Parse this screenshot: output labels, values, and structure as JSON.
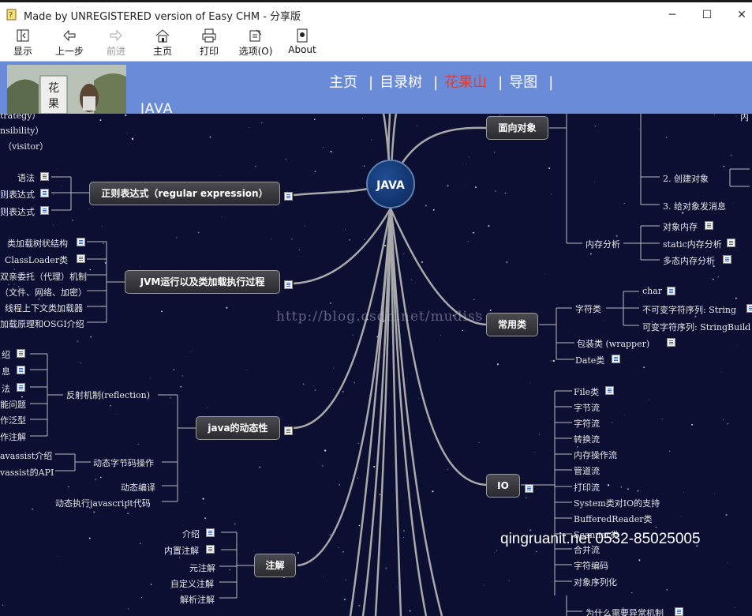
{
  "window": {
    "title": "Made by UNREGISTERED version of Easy CHM - 分享版",
    "minimize": "─",
    "maximize": "☐",
    "close": "✕"
  },
  "toolbar": {
    "show": "显示",
    "back": "上一步",
    "forward": "前进",
    "home": "主页",
    "print": "打印",
    "options": "选项(O)",
    "about": "About"
  },
  "header": {
    "nav": [
      "主页",
      "目录树",
      "花果山",
      "导图"
    ],
    "separator": "|",
    "active_index": 2,
    "java_label": "JAVA"
  },
  "mindmap": {
    "center": "JAVA",
    "main_nodes": {
      "oop": "面向对象",
      "regex": "正则表达式（regular expression）",
      "jvm": "JVM运行以及类加载执行过程",
      "common": "常用类",
      "dynamic": "java的动态性",
      "io": "IO",
      "annotation": "注解"
    },
    "leaves": {
      "strategy": "trategy）",
      "responsibility": "nsibility）",
      "visitor": "（visitor）",
      "regex_syntax": "语法",
      "regex_2": "则表达式",
      "regex_3": "则表达式",
      "jvm_1": "类加载树状结构",
      "jvm_2": "ClassLoader类",
      "jvm_3": "双亲委托（代理）机制",
      "jvm_4": "（文件、网络、加密）",
      "jvm_5": "线程上下文类加载器",
      "jvm_6": "加载原理和OSGI介绍",
      "dyn_reflection": "反射机制(reflection)",
      "dyn_bytecode": "动态字节码操作",
      "dyn_compile": "动态编译",
      "dyn_js": "动态执行javascript代码",
      "dyn_l1": "绍",
      "dyn_l2": "息",
      "dyn_l3": "法",
      "dyn_l4": "能问题",
      "dyn_l5": "作泛型",
      "dyn_l6": "作注解",
      "javassist_1": "avassist介绍",
      "javassist_2": "vassist的API",
      "ann_1": "介绍",
      "ann_2": "内置注解",
      "ann_3": "元注解",
      "ann_4": "自定义注解",
      "ann_5": "解析注解",
      "oop_create": "2. 创建对象",
      "oop_msg": "3. 给对象发消息",
      "oop_mem": "内存分析",
      "mem_1": "对象内存",
      "mem_2": "static内存分析",
      "mem_3": "多态内存分析",
      "oop_right": "内",
      "common_string": "字符类",
      "common_char": "char",
      "common_immutable": "不可变字符序列: String",
      "common_mutable": "可变字符序列: StringBuild",
      "common_wrapper": "包装类 (wrapper)",
      "common_date": "Date类",
      "io_file": "File类",
      "io_byte": "字节流",
      "io_char": "字符流",
      "io_convert": "转换流",
      "io_memory": "内存操作流",
      "io_pipe": "管道流",
      "io_print": "打印流",
      "io_system": "System类对IO的支持",
      "io_buffered": "BufferedReader类",
      "io_scanner": "Scanner类",
      "io_merge": "合并流",
      "io_encoding": "字符编码",
      "io_serial": "对象序列化",
      "exception": "为什么需要异常机制"
    }
  },
  "watermarks": {
    "blog": "http://blog.csdn.net/mudiss",
    "site": "qingruanit.net 0532-85025005"
  },
  "colors": {
    "header_bg": "#6a8bd7",
    "canvas_bg": "#0c0f32",
    "active_nav": "#e53b2c",
    "center_node": "#1f4e95"
  }
}
